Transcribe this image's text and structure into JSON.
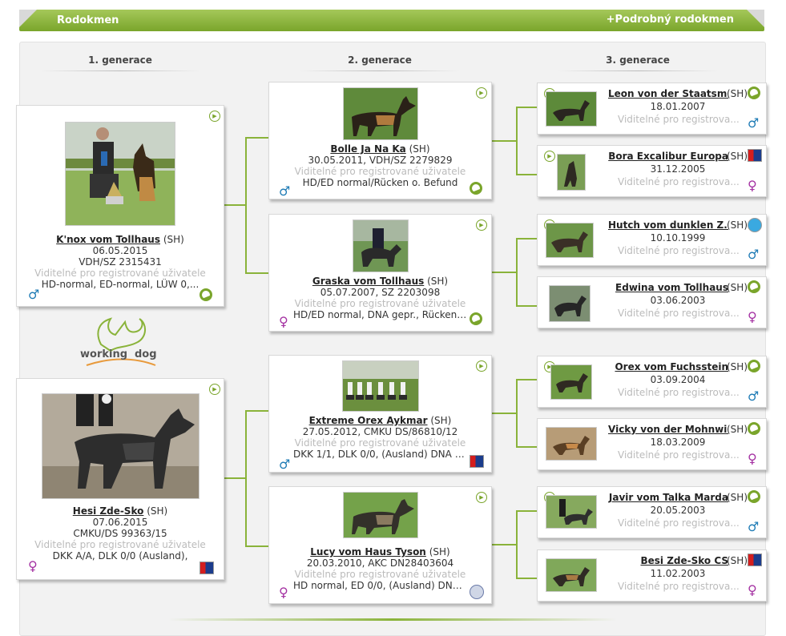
{
  "header": {
    "title": "Rodokmen",
    "detailed_link": "+Podrobný rodokmen"
  },
  "generations": [
    "1. generace",
    "2. generace",
    "3. generace"
  ],
  "registered_text_full": "Viditelné pro registrované uživatele",
  "registered_text_short": "Viditelné pro registrova...",
  "logo_text": {
    "word1": "working",
    "word2": "dog"
  },
  "gen1": [
    {
      "name": "K'nox vom Tollhaus",
      "breed": "(SH)",
      "date": "06.05.2015",
      "reg": "VDH/SZ 2315431",
      "health": "HD-normal, ED-normal, LÜW 0,...",
      "sex_symbol": "♂",
      "sex": "male",
      "badge": "green-stamp"
    },
    {
      "name": "Hesi Zde-Sko",
      "breed": "(SH)",
      "date": "07.06.2015",
      "reg": "CMKU/DS 99363/15",
      "health": "DKK A/A, DLK 0/0 (Ausland),",
      "sex_symbol": "♀",
      "sex": "female",
      "badge": "flag"
    }
  ],
  "gen2": [
    {
      "name": "Bolle Ja Na Ka",
      "breed": "(SH)",
      "info": "30.05.2011, VDH/SZ 2279829",
      "health": "HD/ED normal/Rücken o. Befund",
      "sex_symbol": "♂",
      "sex": "male",
      "badge": "green-stamp"
    },
    {
      "name": "Graska vom Tollhaus",
      "breed": "(SH)",
      "info": "05.07.2007, SZ 2203098",
      "health": "HD/ED normal, DNA gepr., Rücken o...",
      "sex_symbol": "♀",
      "sex": "female",
      "badge": "green-stamp"
    },
    {
      "name": "Extreme Orex Aykmar",
      "breed": "(SH)",
      "info": "27.05.2012, CMKU DS/86810/12",
      "health": "DKK 1/1, DLK 0/0, (Ausland) DNA gpr.",
      "sex_symbol": "♂",
      "sex": "male",
      "badge": "flag"
    },
    {
      "name": "Lucy vom Haus Tyson",
      "breed": "(SH)",
      "info": "20.03.2010, AKC DN28403604",
      "health": "HD normal, ED 0/0, (Ausland) DNA g...",
      "sex_symbol": "♀",
      "sex": "female",
      "badge": "gray-circle"
    }
  ],
  "gen3": [
    {
      "name": "Leon von der Staatsm...",
      "breed": "(SH)",
      "date": "18.01.2007",
      "sex_symbol": "♂",
      "sex": "male",
      "badge": "green-stamp"
    },
    {
      "name": "Bora Excalibur Europa",
      "breed": "(SH)",
      "date": "31.12.2005",
      "sex_symbol": "♀",
      "sex": "female",
      "badge": "flag"
    },
    {
      "name": "Hutch vom dunklen Z...",
      "breed": "(SH)",
      "date": "10.10.1999",
      "sex_symbol": "♂",
      "sex": "male",
      "badge": "blue-circle"
    },
    {
      "name": "Edwina vom Tollhaus",
      "breed": "(SH)",
      "date": "03.06.2003",
      "sex_symbol": "♀",
      "sex": "female",
      "badge": "green-stamp"
    },
    {
      "name": "Orex vom Fuchsstein",
      "breed": "(SH)",
      "date": "03.09.2004",
      "sex_symbol": "♂",
      "sex": "male",
      "badge": "green-stamp"
    },
    {
      "name": "Vicky von der Mohnwi...",
      "breed": "(SH)",
      "date": "18.03.2009",
      "sex_symbol": "♀",
      "sex": "female",
      "badge": "green-stamp"
    },
    {
      "name": "Javir vom Talka Marda",
      "breed": "(SH)",
      "date": "20.05.2003",
      "sex_symbol": "♂",
      "sex": "male",
      "badge": "green-stamp"
    },
    {
      "name": "Besi Zde-Sko CS",
      "breed": "(SH)",
      "date": "11.02.2003",
      "sex_symbol": "♀",
      "sex": "female",
      "badge": "flag"
    }
  ],
  "colors": {
    "accent": "#7aa52b",
    "male": "#1e7bb5",
    "female": "#a431a2"
  }
}
